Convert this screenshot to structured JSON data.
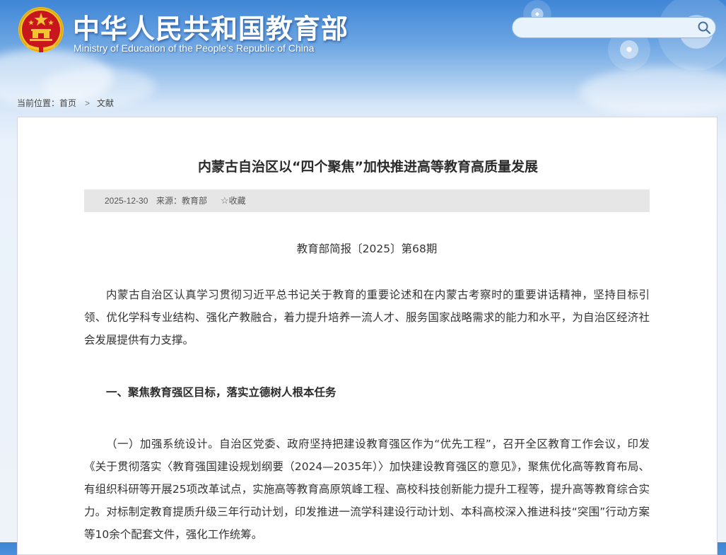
{
  "header": {
    "site_title_cn": "中华人民共和国教育部",
    "site_title_en": "Ministry of Education of the People's Republic of China",
    "search": {
      "placeholder": ""
    }
  },
  "breadcrumb": {
    "label": "当前位置：",
    "home": "首页",
    "separator": ">",
    "current": "文献"
  },
  "article": {
    "title": "内蒙古自治区以“四个聚焦”加快推进高等教育高质量发展",
    "meta": {
      "date": "2025-12-30",
      "source": "来源：教育部",
      "favorite_label": "收藏"
    },
    "issue": "教育部简报〔2025〕第68期",
    "paragraphs": [
      "内蒙古自治区认真学习贯彻习近平总书记关于教育的重要论述和在内蒙古考察时的重要讲话精神，坚持目标引领、优化学科专业结构、强化产教融合，着力提升培养一流人才、服务国家战略需求的能力和水平，为自治区经济社会发展提供有力支撑。",
      "一、聚焦教育强区目标，落实立德树人根本任务",
      "（一）加强系统设计。自治区党委、政府坚持把建设教育强区作为“优先工程”，召开全区教育工作会议，印发《关于贯彻落实〈教育强国建设规划纲要（2024—2035年）〉加快建设教育强区的意见》，聚焦优化高等教育布局、有组织科研等开展25项改革试点，实施高等教育高原筑峰工程、高校科技创新能力提升工程等，提升高等教育综合实力。对标制定教育提质升级三年行动计划，印发推进一流学科建设行动计划、本科高校深入推进科技“突围”行动方案等10余个配套文件，强化工作统筹。"
    ]
  },
  "colors": {
    "sky_top": "#3f86d6",
    "emblem_red": "#c8161d",
    "emblem_gold": "#f4c430",
    "meta_bar": "#e6e6e6"
  },
  "icons": [
    "national-emblem-icon",
    "search-icon",
    "star-icon"
  ]
}
